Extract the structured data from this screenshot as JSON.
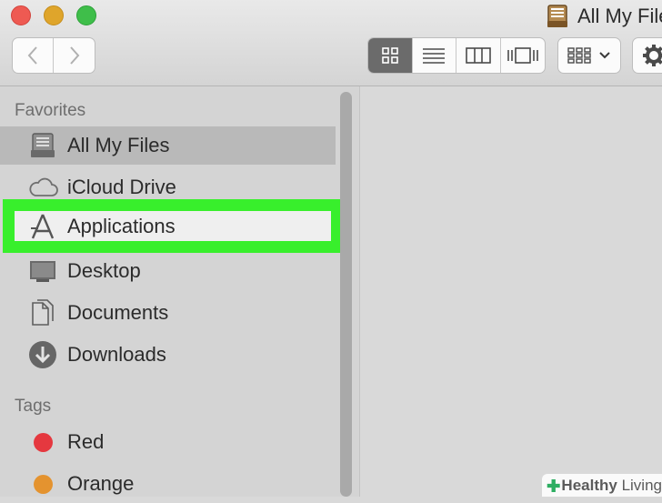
{
  "window": {
    "title": "All My Files"
  },
  "toolbar": {
    "traffic_lights": [
      "close",
      "minimize",
      "zoom"
    ],
    "nav": {
      "back_icon": "chevron-left-icon",
      "forward_icon": "chevron-right-icon"
    },
    "view_modes": [
      "icon-view-icon",
      "list-view-icon",
      "column-view-icon",
      "cover-flow-icon"
    ],
    "active_view": "icon-view-icon",
    "arrange_icon": "arrange-grid-icon",
    "action_icon": "gear-icon"
  },
  "sidebar": {
    "favorites_title": "Favorites",
    "favorites": [
      {
        "label": "All My Files",
        "icon": "all-my-files-icon",
        "selected": true
      },
      {
        "label": "iCloud Drive",
        "icon": "cloud-icon"
      },
      {
        "label": "Applications",
        "icon": "applications-icon",
        "highlighted": true
      },
      {
        "label": "Desktop",
        "icon": "desktop-icon"
      },
      {
        "label": "Documents",
        "icon": "documents-icon"
      },
      {
        "label": "Downloads",
        "icon": "downloads-icon"
      }
    ],
    "tags_title": "Tags",
    "tags": [
      {
        "label": "Red",
        "color": "#e5383f"
      },
      {
        "label": "Orange",
        "color": "#e4932f"
      }
    ]
  },
  "colors": {
    "highlight_border": "#38ef2c",
    "selected_row": "#b9b9b9",
    "active_segment": "#6b6b6b"
  },
  "watermark": {
    "brand_bold": "Healthy",
    "brand_light": "Living"
  }
}
